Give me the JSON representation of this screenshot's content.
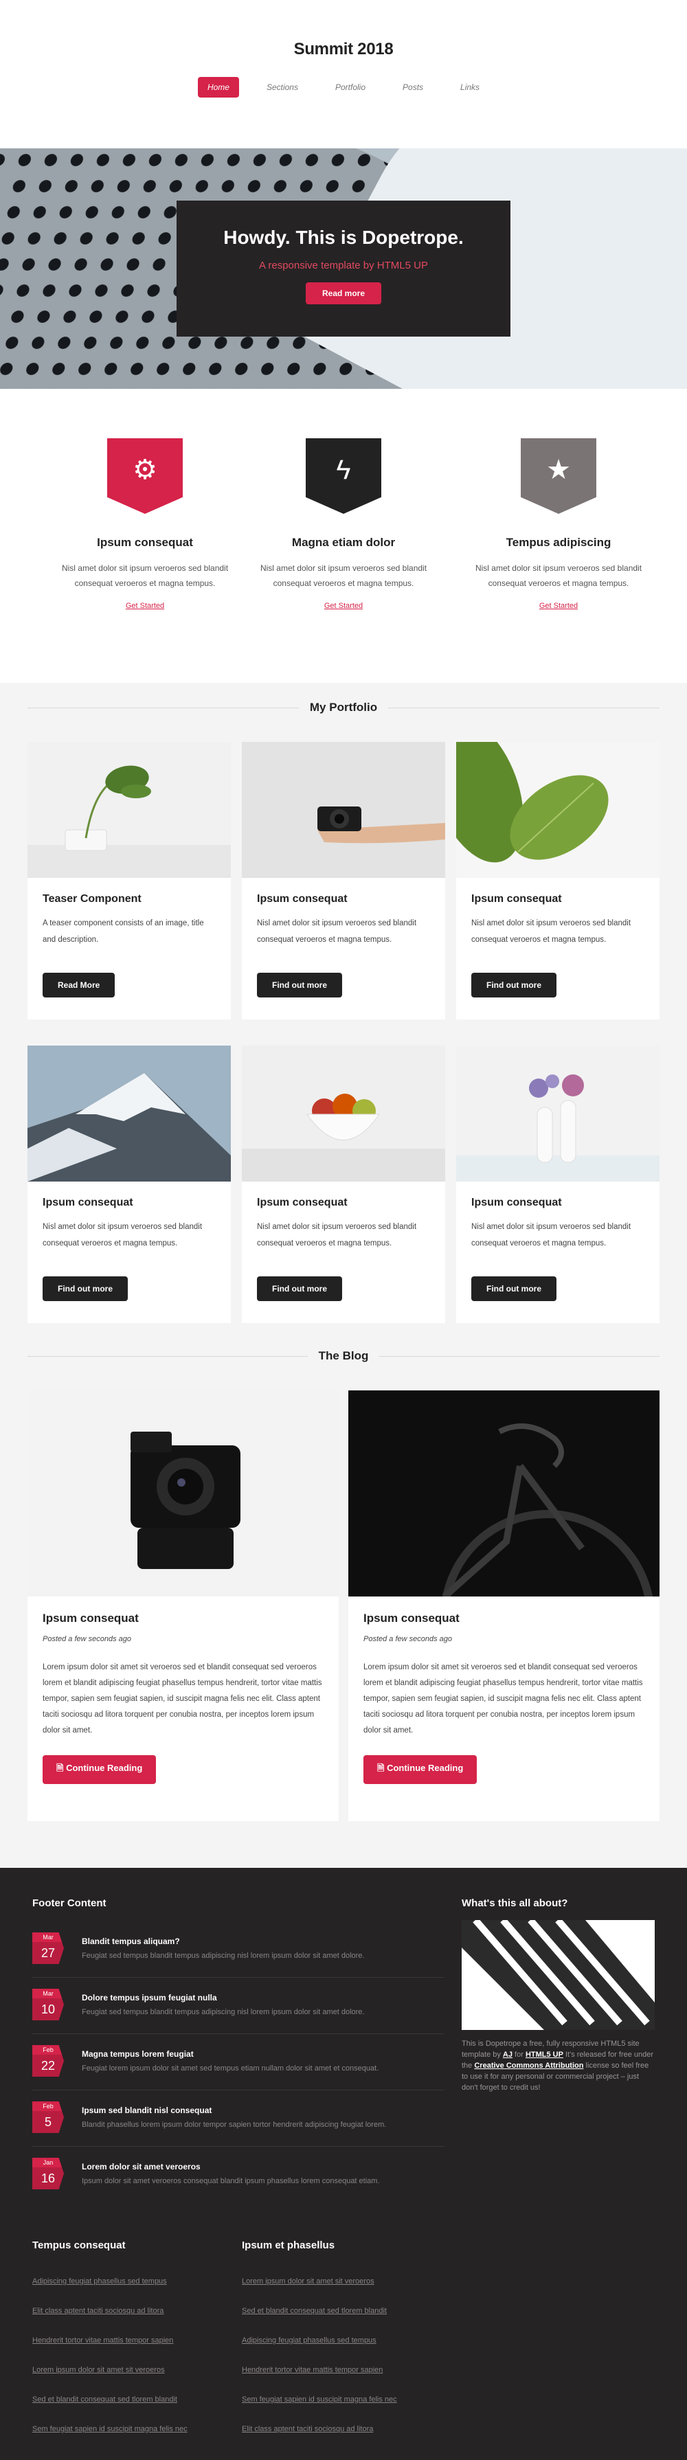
{
  "site_title": "Summit 2018",
  "nav": [
    {
      "label": "Home",
      "active": true
    },
    {
      "label": "Sections",
      "active": false
    },
    {
      "label": "Portfolio",
      "active": false
    },
    {
      "label": "Posts",
      "active": false
    },
    {
      "label": "Links",
      "active": false
    }
  ],
  "banner": {
    "heading": "Howdy. This is Dopetrope.",
    "subheading": "A responsive template by HTML5 UP",
    "button": "Read more"
  },
  "features": [
    {
      "icon": "gear-icon",
      "color": "#d52349",
      "title": "Ipsum consequat",
      "text": "Nisl amet dolor sit ipsum veroeros sed blandit consequat veroeros et magna tempus.",
      "link": "Get Started"
    },
    {
      "icon": "lightning-icon",
      "color": "#222222",
      "title": "Magna etiam dolor",
      "text": "Nisl amet dolor sit ipsum veroeros sed blandit consequat veroeros et magna tempus.",
      "link": "Get Started"
    },
    {
      "icon": "star-icon",
      "color": "#7b7474",
      "title": "Tempus adipiscing",
      "text": "Nisl amet dolor sit ipsum veroeros sed blandit consequat veroeros et magna tempus.",
      "link": "Get Started"
    }
  ],
  "portfolio": {
    "title": "My Portfolio",
    "cards": [
      {
        "title": "Teaser Component",
        "text": "A teaser component consists of an image, title and description.",
        "button": "Read More",
        "image": "plant-vase-photo"
      },
      {
        "title": "Ipsum consequat",
        "text": "Nisl amet dolor sit ipsum veroeros sed blandit consequat veroeros et magna tempus.",
        "button": "Find out more",
        "image": "camera-in-hand-photo"
      },
      {
        "title": "Ipsum consequat",
        "text": "Nisl amet dolor sit ipsum veroeros sed blandit consequat veroeros et magna tempus.",
        "button": "Find out more",
        "image": "green-leaf-photo"
      },
      {
        "title": "Ipsum consequat",
        "text": "Nisl amet dolor sit ipsum veroeros sed blandit consequat veroeros et magna tempus.",
        "button": "Find out more",
        "image": "snowy-mountain-photo"
      },
      {
        "title": "Ipsum consequat",
        "text": "Nisl amet dolor sit ipsum veroeros sed blandit consequat veroeros et magna tempus.",
        "button": "Find out more",
        "image": "fruit-bowl-photo"
      },
      {
        "title": "Ipsum consequat",
        "text": "Nisl amet dolor sit ipsum veroeros sed blandit consequat veroeros et magna tempus.",
        "button": "Find out more",
        "image": "flower-vases-photo"
      }
    ]
  },
  "blog": {
    "title": "The Blog",
    "posts": [
      {
        "title": "Ipsum consequat",
        "date": "Posted a few seconds ago",
        "text": "Lorem ipsum dolor sit amet sit veroeros sed et blandit consequat sed veroeros lorem et blandit adipiscing feugiat phasellus tempus hendrerit, tortor vitae mattis tempor, sapien sem feugiat sapien, id suscipit magna felis nec elit. Class aptent taciti sociosqu ad litora torquent per conubia nostra, per inceptos lorem ipsum dolor sit amet.",
        "button": "Continue Reading",
        "image": "camera-on-white-photo"
      },
      {
        "title": "Ipsum consequat",
        "date": "Posted a few seconds ago",
        "text": "Lorem ipsum dolor sit amet sit veroeros sed et blandit consequat sed veroeros lorem et blandit adipiscing feugiat phasellus tempus hendrerit, tortor vitae mattis tempor, sapien sem feugiat sapien, id suscipit magna felis nec elit. Class aptent taciti sociosqu ad litora torquent per conubia nostra, per inceptos lorem ipsum dolor sit amet.",
        "button": "Continue Reading",
        "image": "bicycle-dark-photo"
      }
    ]
  },
  "footer": {
    "feed_title": "Footer Content",
    "feed": [
      {
        "month": "Mar",
        "day": "27",
        "title": "Blandit tempus aliquam?",
        "text": "Feugiat sed tempus blandit tempus adipiscing nisl lorem ipsum dolor sit amet dolore."
      },
      {
        "month": "Mar",
        "day": "10",
        "title": "Dolore tempus ipsum feugiat nulla",
        "text": "Feugiat sed tempus blandit tempus adipiscing nisl lorem ipsum dolor sit amet dolore."
      },
      {
        "month": "Feb",
        "day": "22",
        "title": "Magna tempus lorem feugiat",
        "text": "Feugiat lorem ipsum dolor sit amet sed tempus etiam nullam dolor sit amet et consequat."
      },
      {
        "month": "Feb",
        "day": "5",
        "title": "Ipsum sed blandit nisl consequat",
        "text": "Blandit phasellus lorem ipsum dolor tempor sapien tortor hendrerit adipiscing feugiat lorem."
      },
      {
        "month": "Jan",
        "day": "16",
        "title": "Lorem dolor sit amet veroeros",
        "text": "Ipsum dolor sit amet veroeros consequat blandit ipsum phasellus lorem consequat etiam."
      }
    ],
    "about_title": "What's this all about?",
    "about_text_1": "This is ",
    "about_text_2": "Dopetrope",
    "about_text_3": " a free, fully responsive HTML5 site template by ",
    "about_aj": "AJ",
    "about_for": " for ",
    "about_html5up": "HTML5 UP",
    "about_text_4": " It's released for free under the ",
    "about_cc": "Creative Commons Attribution",
    "about_text_5": " license so feel free to use it for any personal or commercial project – just don't forget to credit us!",
    "links_1_title": "Tempus consequat",
    "links_1": [
      "Adipiscing feugiat phasellus sed tempus",
      "Elit class aptent taciti sociosqu ad litora",
      "Hendrerit tortor vitae mattis tempor sapien",
      "Lorem ipsum dolor sit amet sit veroeros",
      "Sed et blandit consequat sed tlorem blandit",
      "Sem feugiat sapien id suscipit magna felis nec"
    ],
    "links_2_title": "Ipsum et phasellus",
    "links_2": [
      "Lorem ipsum dolor sit amet sit veroeros",
      "Sed et blandit consequat sed tlorem blandit",
      "Adipiscing feugiat phasellus sed tempus",
      "Hendrerit tortor vitae mattis tempor sapien",
      "Sem feugiat sapien id suscipit magna felis nec",
      "Elit class aptent taciti sociosqu ad litora"
    ]
  }
}
